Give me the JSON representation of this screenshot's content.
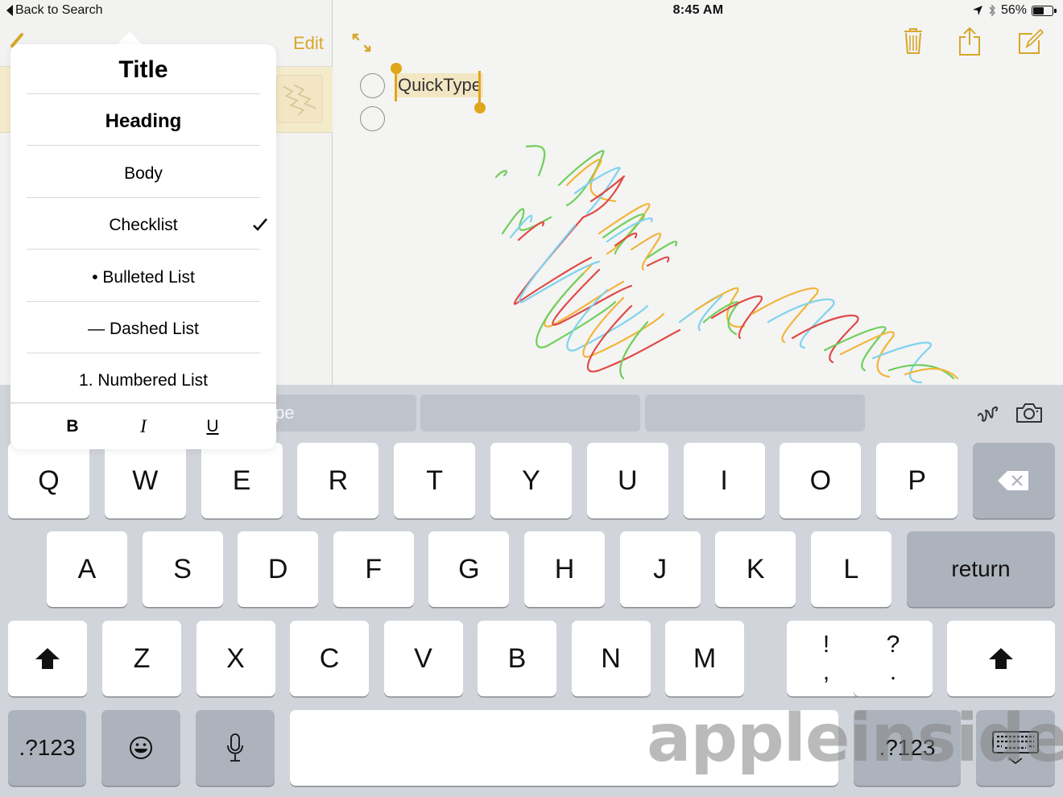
{
  "status_bar": {
    "back_label": "Back to Search",
    "time": "8:45 AM",
    "battery_percent": "56%",
    "battery_level": 0.56,
    "icons": [
      "location-arrow-icon",
      "bluetooth-icon",
      "battery-icon"
    ]
  },
  "sidebar": {
    "edit_label": "Edit",
    "compose_icon": "pencil-icon"
  },
  "toolbar": {
    "icons": [
      "expand-icon",
      "trash-icon",
      "share-icon",
      "compose-icon"
    ]
  },
  "note": {
    "checklist": [
      {
        "text": "QuickType",
        "checked": false,
        "selected": true
      },
      {
        "text": "",
        "checked": false,
        "selected": false
      }
    ],
    "drawing_colors": [
      "#6fcf5b",
      "#f2b53a",
      "#e04a45",
      "#7fd3ee"
    ]
  },
  "format_popover": {
    "items": [
      {
        "label": "Title",
        "style": "title",
        "checked": false
      },
      {
        "label": "Heading",
        "style": "heading",
        "checked": false
      },
      {
        "label": "Body",
        "style": "body",
        "checked": false
      },
      {
        "label": "Checklist",
        "style": "body",
        "checked": true
      },
      {
        "label": "• Bulleted List",
        "style": "body",
        "checked": false
      },
      {
        "label": "— Dashed List",
        "style": "body",
        "checked": false
      },
      {
        "label": "1. Numbered List",
        "style": "body",
        "checked": false
      }
    ],
    "text_styles": {
      "bold": "B",
      "italic": "I",
      "underline": "U"
    }
  },
  "keyboard": {
    "quicktype_suggestions": [
      "Quick Type",
      "",
      ""
    ],
    "row1": [
      "Q",
      "W",
      "E",
      "R",
      "T",
      "Y",
      "U",
      "I",
      "O",
      "P"
    ],
    "row2": [
      "A",
      "S",
      "D",
      "F",
      "G",
      "H",
      "J",
      "K",
      "L"
    ],
    "row3": [
      "Z",
      "X",
      "C",
      "V",
      "B",
      "N",
      "M"
    ],
    "punct1": {
      "top": "!",
      "bottom": ","
    },
    "punct2": {
      "top": "?",
      "bottom": "."
    },
    "return_label": "return",
    "numbers_label": ".?123",
    "numbers_label_right": ".?123"
  },
  "watermark": "appleinsider",
  "colors": {
    "accent": "#d7a72a",
    "selection": "#e0a619",
    "key_dark": "#adb3bc",
    "keyboard_bg": "#d1d4da"
  }
}
